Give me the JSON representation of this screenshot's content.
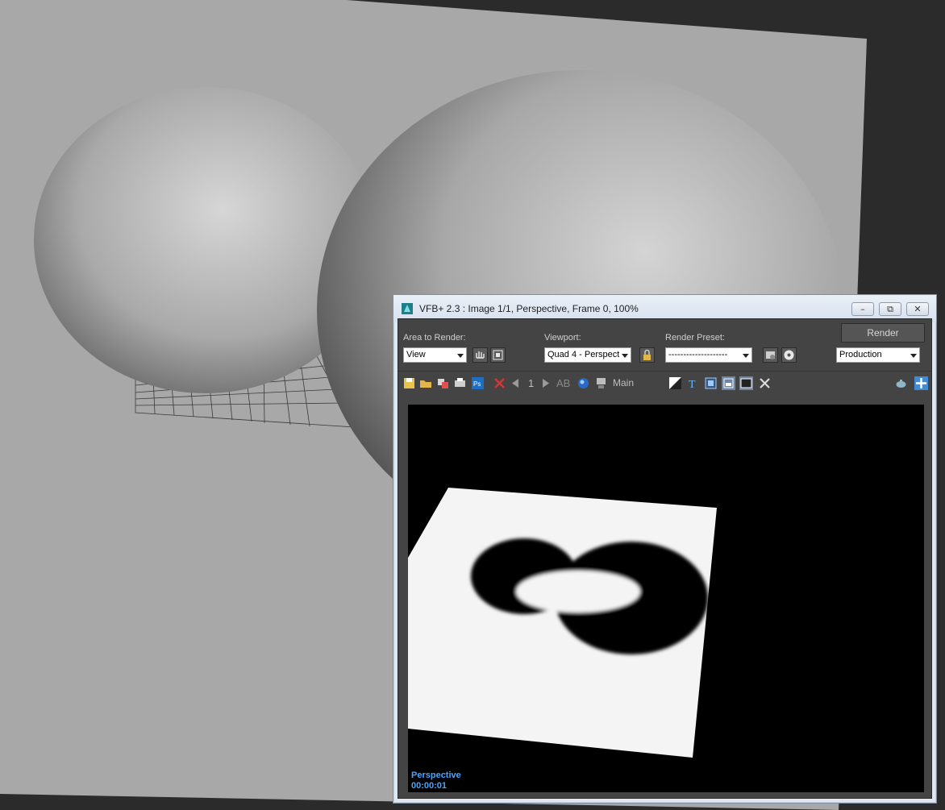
{
  "vfb": {
    "title": "VFB+ 2.3 : Image 1/1, Perspective, Frame 0, 100%",
    "window_buttons": {
      "minimize": "–",
      "restore": "⧉",
      "close": "✕"
    },
    "area_to_render": {
      "label": "Area to Render:",
      "value": "View"
    },
    "viewport": {
      "label": "Viewport:",
      "value": "Quad 4 - Perspect"
    },
    "render_preset": {
      "label": "Render Preset:",
      "value": "--------------------"
    },
    "render_button": "Render",
    "production": {
      "value": "Production"
    },
    "toolbar": {
      "frame_number": "1",
      "ab_label": "AB",
      "channel": "Main"
    },
    "render": {
      "camera": "Perspective",
      "time": "00:00:01"
    }
  },
  "colors": {
    "viewport_bg": "#2b2b2b",
    "plane": "#a8a8a8",
    "panel": "#444444",
    "overlay_text": "#4aa3ff"
  }
}
